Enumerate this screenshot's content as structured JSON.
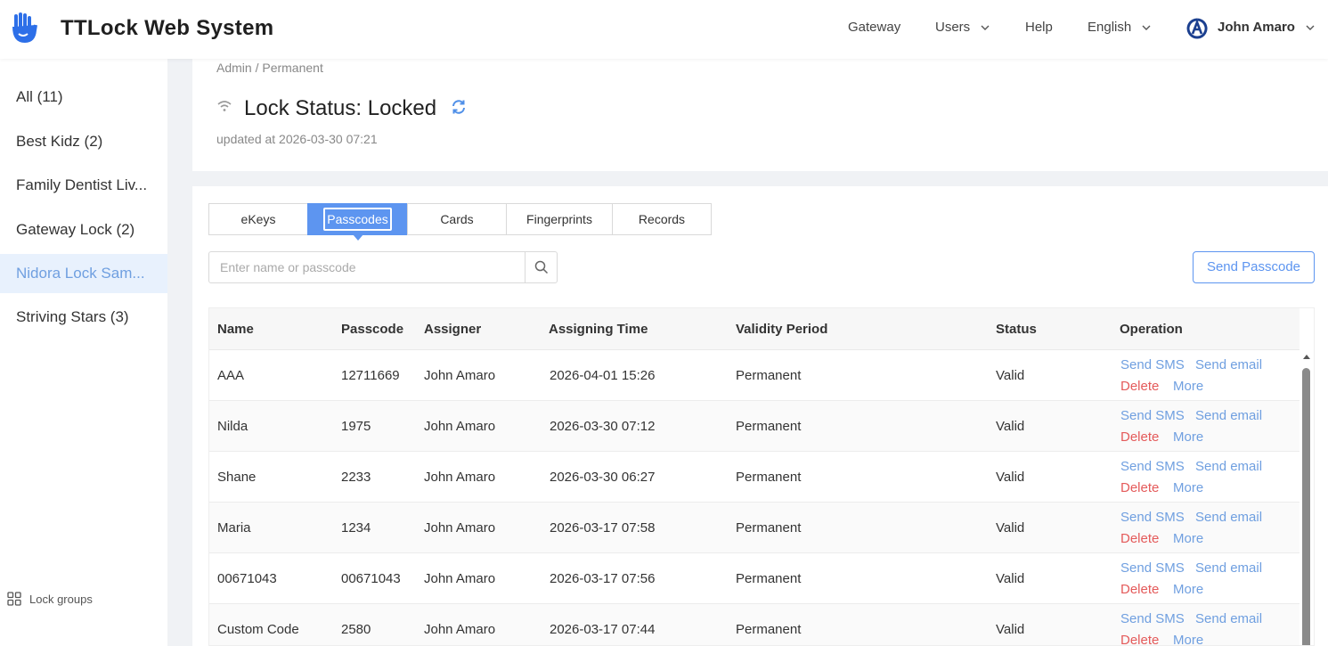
{
  "header": {
    "title": "TTLock Web System",
    "nav": {
      "gateway": "Gateway",
      "users": "Users",
      "help": "Help",
      "language": "English",
      "user": "John Amaro"
    }
  },
  "sidebar": {
    "items": [
      {
        "label": "All (11)",
        "active": false
      },
      {
        "label": "Best Kidz (2)",
        "active": false
      },
      {
        "label": "Family Dentist Liv...",
        "active": false
      },
      {
        "label": "Gateway Lock (2)",
        "active": false
      },
      {
        "label": "Nidora Lock Sam...",
        "active": true
      },
      {
        "label": "Striving Stars (3)",
        "active": false
      }
    ],
    "footer_label": "Lock groups"
  },
  "lock": {
    "breadcrumb": "Admin / Permanent",
    "status": "Lock Status: Locked",
    "updated": "updated at 2026-03-30 07:21"
  },
  "tabs": [
    {
      "label": "eKeys",
      "active": false
    },
    {
      "label": "Passcodes",
      "active": true
    },
    {
      "label": "Cards",
      "active": false
    },
    {
      "label": "Fingerprints",
      "active": false
    },
    {
      "label": "Records",
      "active": false
    }
  ],
  "search": {
    "placeholder": "Enter name or passcode",
    "value": ""
  },
  "send_passcode_label": "Send Passcode",
  "table": {
    "columns": [
      "Name",
      "Passcode",
      "Assigner",
      "Assigning Time",
      "Validity Period",
      "Status",
      "Operation"
    ],
    "operations": {
      "send_sms": "Send SMS",
      "send_email": "Send email",
      "delete": "Delete",
      "more": "More"
    },
    "rows": [
      {
        "name": "AAA",
        "passcode": "12711669",
        "assigner": "John Amaro",
        "time": "2026-04-01 15:26",
        "validity": "Permanent",
        "status": "Valid"
      },
      {
        "name": "Nilda",
        "passcode": "1975",
        "assigner": "John Amaro",
        "time": "2026-03-30 07:12",
        "validity": "Permanent",
        "status": "Valid"
      },
      {
        "name": "Shane",
        "passcode": "2233",
        "assigner": "John Amaro",
        "time": "2026-03-30 06:27",
        "validity": "Permanent",
        "status": "Valid"
      },
      {
        "name": "Maria",
        "passcode": "1234",
        "assigner": "John Amaro",
        "time": "2026-03-17 07:58",
        "validity": "Permanent",
        "status": "Valid"
      },
      {
        "name": "00671043",
        "passcode": "00671043",
        "assigner": "John Amaro",
        "time": "2026-03-17 07:56",
        "validity": "Permanent",
        "status": "Valid"
      },
      {
        "name": "Custom Code",
        "passcode": "2580",
        "assigner": "John Amaro",
        "time": "2026-03-17 07:44",
        "validity": "Permanent",
        "status": "Valid"
      }
    ]
  },
  "colors": {
    "accent": "#5d95f0",
    "link": "#6f9fe0",
    "danger": "#e45a5a",
    "active_bg": "#e8f1fd"
  }
}
